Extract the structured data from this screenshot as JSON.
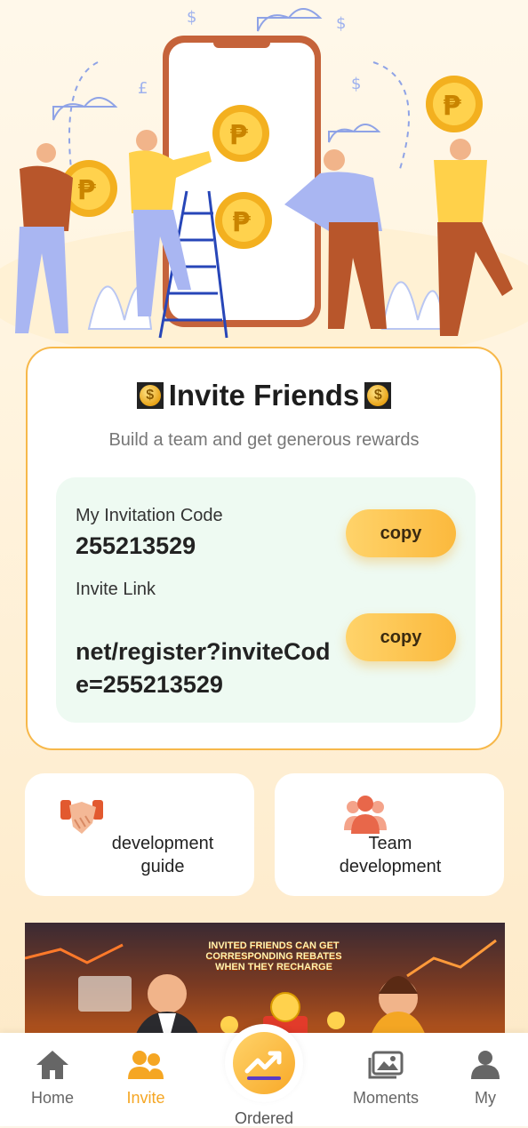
{
  "invite": {
    "title": "Invite Friends",
    "subtitle": "Build a team and get generous rewards",
    "code_label": "My Invitation Code",
    "code_value": "255213529",
    "link_label": "Invite Link",
    "link_value": "net/register?inviteCode=255213529",
    "copy_label": "copy"
  },
  "features": [
    {
      "label": "development guide",
      "icon": "handshake-icon"
    },
    {
      "label": "Team development",
      "icon": "team-icon"
    }
  ],
  "banner": {
    "text": "INVITED FRIENDS CAN GET CORRESPONDING REBATES WHEN THEY RECHARGE"
  },
  "tabs": [
    {
      "label": "Home",
      "icon": "home-icon",
      "active": false
    },
    {
      "label": "Invite",
      "icon": "users-icon",
      "active": true
    },
    {
      "label": "Ordered",
      "icon": "trend-icon",
      "active": false
    },
    {
      "label": "Moments",
      "icon": "gallery-icon",
      "active": false
    },
    {
      "label": "My",
      "icon": "user-icon",
      "active": false
    }
  ],
  "colors": {
    "accent": "#f5a623",
    "card_border": "#f7b84a",
    "panel_bg": "#eefaf2"
  }
}
